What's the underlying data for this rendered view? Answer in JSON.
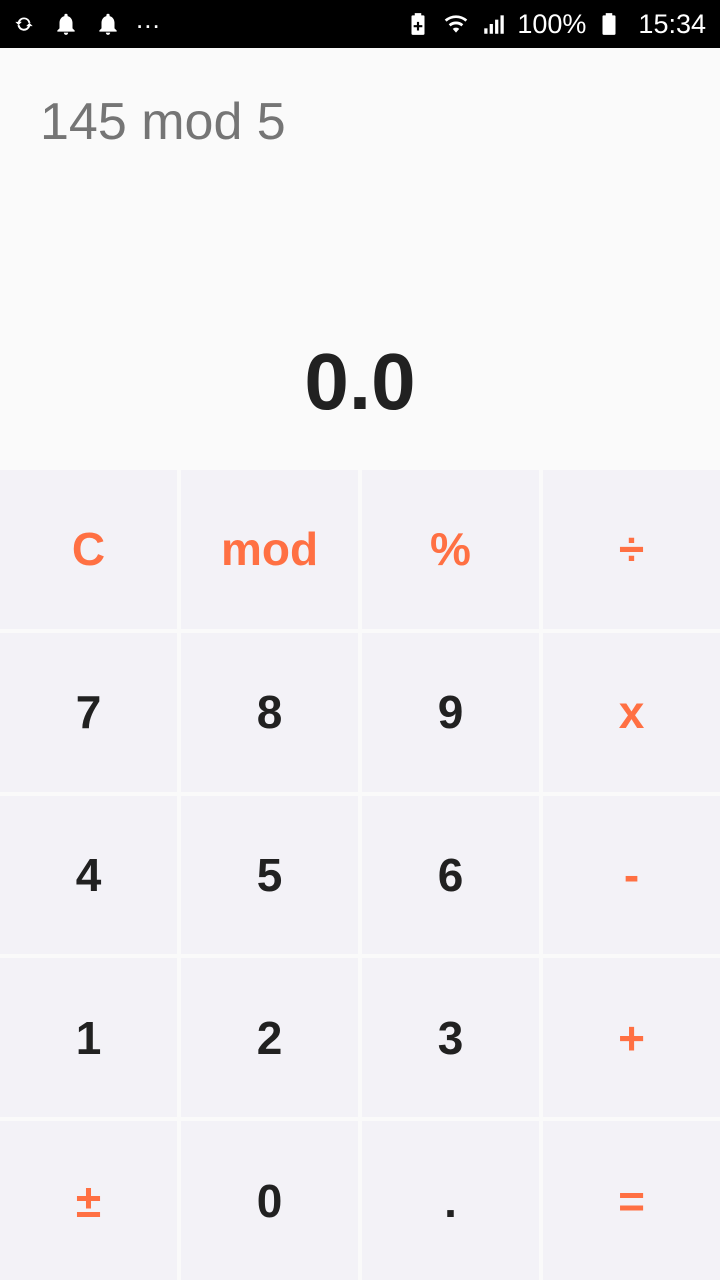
{
  "status_bar": {
    "icons_left": [
      "sync-icon",
      "bell-icon",
      "bell-icon"
    ],
    "more": "...",
    "icons_right": [
      "battery-saver-icon",
      "wifi-icon",
      "signal-icon",
      "battery-icon"
    ],
    "battery_percent": "100%",
    "time": "15:34"
  },
  "display": {
    "expression": "145 mod 5",
    "result": "0.0"
  },
  "keypad": {
    "row1": [
      "C",
      "mod",
      "%",
      "÷"
    ],
    "row2": [
      "7",
      "8",
      "9",
      "x"
    ],
    "row3": [
      "4",
      "5",
      "6",
      "-"
    ],
    "row4": [
      "1",
      "2",
      "3",
      "+"
    ],
    "row5": [
      "±",
      "0",
      ".",
      "="
    ]
  },
  "colors": {
    "accent": "#ff7043",
    "digit": "#212121",
    "key_bg": "#f3f2f7",
    "expression": "#757575"
  }
}
